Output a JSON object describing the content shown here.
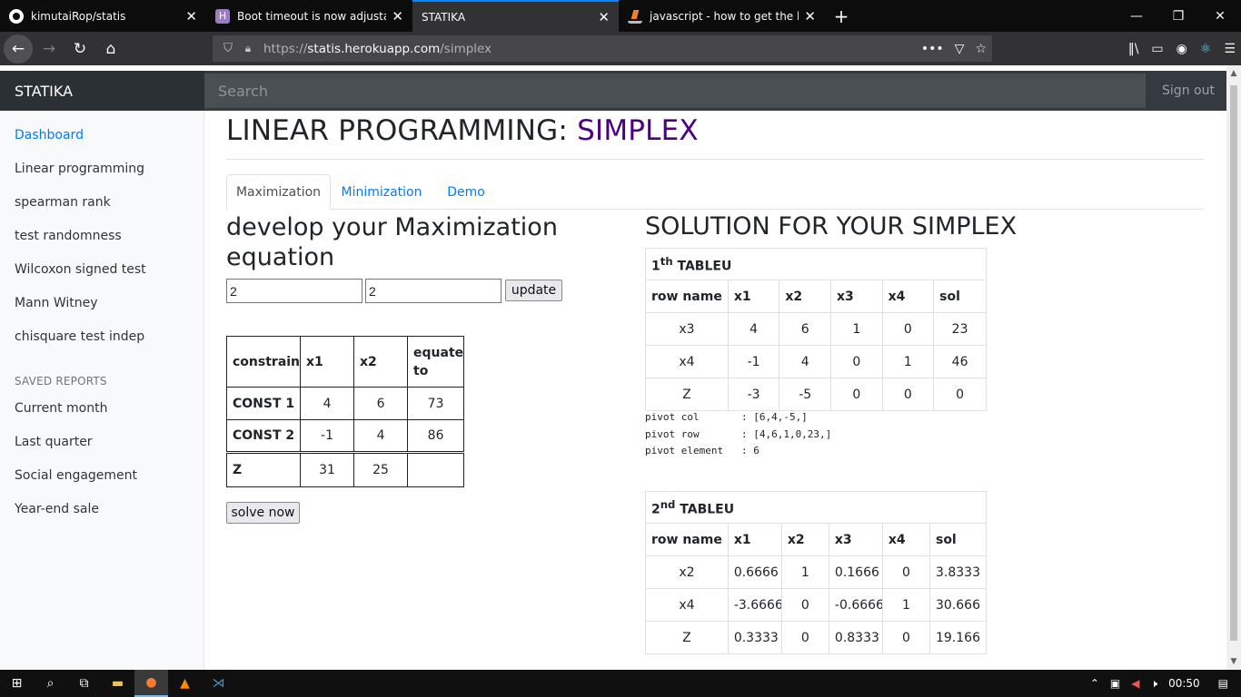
{
  "browser": {
    "tabs": [
      {
        "title": "kimutaiRop/statis",
        "icon": "github-icon"
      },
      {
        "title": "Boot timeout is now adjustable",
        "icon": "heroku-icon"
      },
      {
        "title": "STATIKA",
        "icon": "none"
      },
      {
        "title": "javascript - how to get the last",
        "icon": "stackoverflow-icon"
      }
    ],
    "url_prefix": "https://",
    "url_host": "statis.herokuapp.com",
    "url_path": "/simplex"
  },
  "app": {
    "brand": "STATIKA",
    "search_placeholder": "Search",
    "signout": "Sign out"
  },
  "sidebar": {
    "items": [
      "Dashboard",
      "Linear programming",
      "spearman rank",
      "test randomness",
      "Wilcoxon signed test",
      "Mann Witney",
      "chisquare test indep"
    ],
    "saved_heading": "SAVED REPORTS",
    "saved": [
      "Current month",
      "Last quarter",
      "Social engagement",
      "Year-end sale"
    ]
  },
  "page": {
    "title_prefix": "LINEAR PROGRAMMING: ",
    "title_accent": "SIMPLEX",
    "accent_color": "#4b0082",
    "tabs": [
      "Maximization",
      "Minimization",
      "Demo"
    ]
  },
  "form": {
    "heading": "develop your Maximization equation",
    "var_count": "2",
    "constraint_count": "2",
    "update_label": "update",
    "solve_label": "solve now",
    "table": {
      "headers": [
        "constrain",
        "x1",
        "x2",
        "equate to"
      ],
      "rows": [
        [
          "CONST 1",
          "4",
          "6",
          "73"
        ],
        [
          "CONST 2",
          "-1",
          "4",
          "86"
        ],
        [
          "Z",
          "31",
          "25",
          ""
        ]
      ]
    }
  },
  "solution": {
    "heading": "SOLUTION FOR YOUR SIMPLEX",
    "tableau1": {
      "num": "1",
      "sup": "th",
      "label": " TABLEU",
      "headers": [
        "row name",
        "x1",
        "x2",
        "x3",
        "x4",
        "sol"
      ],
      "rows": [
        [
          "x3",
          "4",
          "6",
          "1",
          "0",
          "23"
        ],
        [
          "x4",
          "-1",
          "4",
          "0",
          "1",
          "46"
        ],
        [
          "Z",
          "-3",
          "-5",
          "0",
          "0",
          "0"
        ]
      ]
    },
    "pivot": {
      "col": "pivot col       : [6,4,-5,]",
      "row": "pivot row       : [4,6,1,0,23,]",
      "element": "pivot element   : 6"
    },
    "tableau2": {
      "num": "2",
      "sup": "nd",
      "label": " TABLEU",
      "headers": [
        "row name",
        "x1",
        "x2",
        "x3",
        "x4",
        "sol"
      ],
      "rows": [
        [
          "x2",
          "0.6666",
          "1",
          "0.1666",
          "0",
          "3.8333"
        ],
        [
          "x4",
          "-3.6666",
          "0",
          "-0.6666",
          "1",
          "30.666"
        ],
        [
          "Z",
          "0.3333",
          "0",
          "0.8333",
          "0",
          "19.166"
        ]
      ]
    }
  },
  "taskbar": {
    "clock": "00:50"
  }
}
